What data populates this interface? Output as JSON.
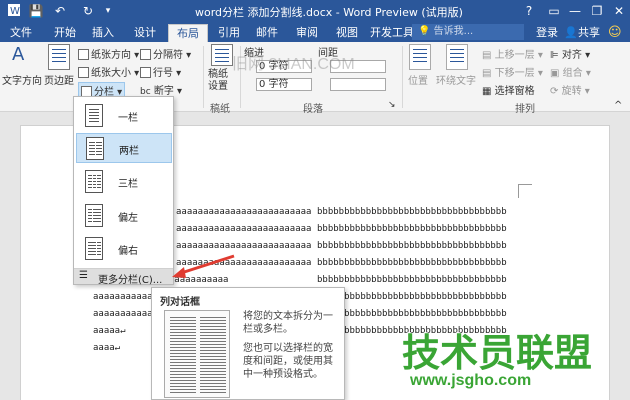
{
  "window": {
    "title": "word分栏 添加分割线.docx - Word Preview (试用版)",
    "help": "?",
    "minimize": "—",
    "restore": "❐",
    "close": "✕"
  },
  "quick_access": {
    "save": "💾",
    "undo": "↶",
    "redo": "↻"
  },
  "tabs": [
    "文件",
    "开始",
    "插入",
    "设计",
    "布局",
    "引用",
    "邮件",
    "审阅",
    "视图",
    "开发工具"
  ],
  "search_placeholder": "告诉我...",
  "account": {
    "login": "登录",
    "share": "共享",
    "smiley": "☺"
  },
  "ribbon": {
    "text_direction": "文字方向",
    "margins": "页边距",
    "orientation": "纸张方向",
    "size": "纸张大小",
    "breaks": "分隔符",
    "line_numbers": "行号",
    "columns": "分栏",
    "hyphenation": "断字",
    "draft_paper": "稿纸\n设置",
    "draft_group": "稿纸",
    "indent": "缩进",
    "spacing": "间距",
    "spin1": "0 字符",
    "spin2": "0 字符",
    "paragraph_group": "段落",
    "position": "位置",
    "wrap_text": "环绕文字",
    "bring_forward": "上移一层",
    "send_backward": "下移一层",
    "selection_pane": "选择窗格",
    "align": "对齐",
    "group": "组合",
    "rotate": "旋转",
    "arrange_group": "排列"
  },
  "column_menu": {
    "items": [
      {
        "label": "一栏"
      },
      {
        "label": "两栏"
      },
      {
        "label": "三栏"
      },
      {
        "label": "偏左"
      },
      {
        "label": "偏右"
      }
    ],
    "more": "更多分栏(C)..."
  },
  "tooltip": {
    "title": "列对话框",
    "text1": "将您的文本拆分为一栏或多栏。",
    "text2": "您也可以选择栏的宽度和间距，或使用其中一种预设格式。"
  },
  "document": {
    "left_full": "aaaaaaaaaaaaaaaaaaaaaaaaa",
    "left_short": "aaaaa↵",
    "left_short2": "aaaa↵",
    "right_line": "bbbbbbbbbbbbbbbbbbbbbbbbbbbbbbbbbbb"
  },
  "watermarks": {
    "site_top": "旧网 3LIAN.COM",
    "brand": "技术员联盟",
    "url": "www.jsgho.com"
  },
  "colors": {
    "title_bar": "#2b579a",
    "arrow": "#e03c31",
    "watermark_green": "#3aa535"
  }
}
